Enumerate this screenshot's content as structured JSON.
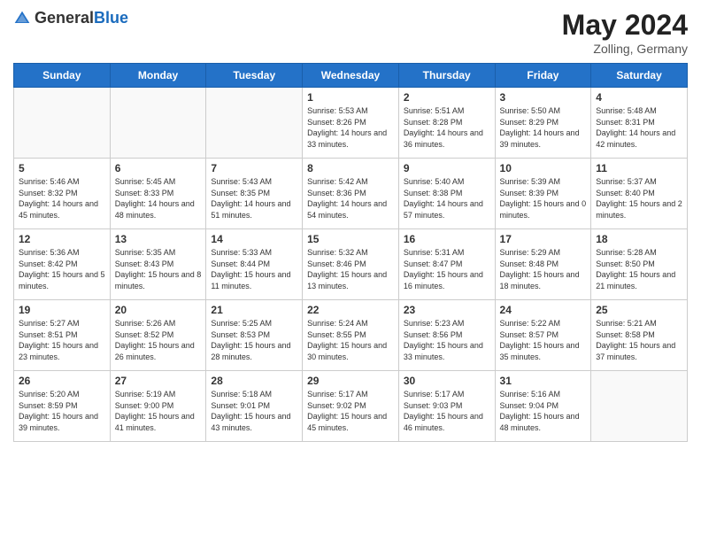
{
  "header": {
    "logo_general": "General",
    "logo_blue": "Blue",
    "month_year": "May 2024",
    "location": "Zolling, Germany"
  },
  "columns": [
    "Sunday",
    "Monday",
    "Tuesday",
    "Wednesday",
    "Thursday",
    "Friday",
    "Saturday"
  ],
  "weeks": [
    [
      {
        "day": "",
        "info": ""
      },
      {
        "day": "",
        "info": ""
      },
      {
        "day": "",
        "info": ""
      },
      {
        "day": "1",
        "info": "Sunrise: 5:53 AM\nSunset: 8:26 PM\nDaylight: 14 hours and 33 minutes."
      },
      {
        "day": "2",
        "info": "Sunrise: 5:51 AM\nSunset: 8:28 PM\nDaylight: 14 hours and 36 minutes."
      },
      {
        "day": "3",
        "info": "Sunrise: 5:50 AM\nSunset: 8:29 PM\nDaylight: 14 hours and 39 minutes."
      },
      {
        "day": "4",
        "info": "Sunrise: 5:48 AM\nSunset: 8:31 PM\nDaylight: 14 hours and 42 minutes."
      }
    ],
    [
      {
        "day": "5",
        "info": "Sunrise: 5:46 AM\nSunset: 8:32 PM\nDaylight: 14 hours and 45 minutes."
      },
      {
        "day": "6",
        "info": "Sunrise: 5:45 AM\nSunset: 8:33 PM\nDaylight: 14 hours and 48 minutes."
      },
      {
        "day": "7",
        "info": "Sunrise: 5:43 AM\nSunset: 8:35 PM\nDaylight: 14 hours and 51 minutes."
      },
      {
        "day": "8",
        "info": "Sunrise: 5:42 AM\nSunset: 8:36 PM\nDaylight: 14 hours and 54 minutes."
      },
      {
        "day": "9",
        "info": "Sunrise: 5:40 AM\nSunset: 8:38 PM\nDaylight: 14 hours and 57 minutes."
      },
      {
        "day": "10",
        "info": "Sunrise: 5:39 AM\nSunset: 8:39 PM\nDaylight: 15 hours and 0 minutes."
      },
      {
        "day": "11",
        "info": "Sunrise: 5:37 AM\nSunset: 8:40 PM\nDaylight: 15 hours and 2 minutes."
      }
    ],
    [
      {
        "day": "12",
        "info": "Sunrise: 5:36 AM\nSunset: 8:42 PM\nDaylight: 15 hours and 5 minutes."
      },
      {
        "day": "13",
        "info": "Sunrise: 5:35 AM\nSunset: 8:43 PM\nDaylight: 15 hours and 8 minutes."
      },
      {
        "day": "14",
        "info": "Sunrise: 5:33 AM\nSunset: 8:44 PM\nDaylight: 15 hours and 11 minutes."
      },
      {
        "day": "15",
        "info": "Sunrise: 5:32 AM\nSunset: 8:46 PM\nDaylight: 15 hours and 13 minutes."
      },
      {
        "day": "16",
        "info": "Sunrise: 5:31 AM\nSunset: 8:47 PM\nDaylight: 15 hours and 16 minutes."
      },
      {
        "day": "17",
        "info": "Sunrise: 5:29 AM\nSunset: 8:48 PM\nDaylight: 15 hours and 18 minutes."
      },
      {
        "day": "18",
        "info": "Sunrise: 5:28 AM\nSunset: 8:50 PM\nDaylight: 15 hours and 21 minutes."
      }
    ],
    [
      {
        "day": "19",
        "info": "Sunrise: 5:27 AM\nSunset: 8:51 PM\nDaylight: 15 hours and 23 minutes."
      },
      {
        "day": "20",
        "info": "Sunrise: 5:26 AM\nSunset: 8:52 PM\nDaylight: 15 hours and 26 minutes."
      },
      {
        "day": "21",
        "info": "Sunrise: 5:25 AM\nSunset: 8:53 PM\nDaylight: 15 hours and 28 minutes."
      },
      {
        "day": "22",
        "info": "Sunrise: 5:24 AM\nSunset: 8:55 PM\nDaylight: 15 hours and 30 minutes."
      },
      {
        "day": "23",
        "info": "Sunrise: 5:23 AM\nSunset: 8:56 PM\nDaylight: 15 hours and 33 minutes."
      },
      {
        "day": "24",
        "info": "Sunrise: 5:22 AM\nSunset: 8:57 PM\nDaylight: 15 hours and 35 minutes."
      },
      {
        "day": "25",
        "info": "Sunrise: 5:21 AM\nSunset: 8:58 PM\nDaylight: 15 hours and 37 minutes."
      }
    ],
    [
      {
        "day": "26",
        "info": "Sunrise: 5:20 AM\nSunset: 8:59 PM\nDaylight: 15 hours and 39 minutes."
      },
      {
        "day": "27",
        "info": "Sunrise: 5:19 AM\nSunset: 9:00 PM\nDaylight: 15 hours and 41 minutes."
      },
      {
        "day": "28",
        "info": "Sunrise: 5:18 AM\nSunset: 9:01 PM\nDaylight: 15 hours and 43 minutes."
      },
      {
        "day": "29",
        "info": "Sunrise: 5:17 AM\nSunset: 9:02 PM\nDaylight: 15 hours and 45 minutes."
      },
      {
        "day": "30",
        "info": "Sunrise: 5:17 AM\nSunset: 9:03 PM\nDaylight: 15 hours and 46 minutes."
      },
      {
        "day": "31",
        "info": "Sunrise: 5:16 AM\nSunset: 9:04 PM\nDaylight: 15 hours and 48 minutes."
      },
      {
        "day": "",
        "info": ""
      }
    ]
  ]
}
